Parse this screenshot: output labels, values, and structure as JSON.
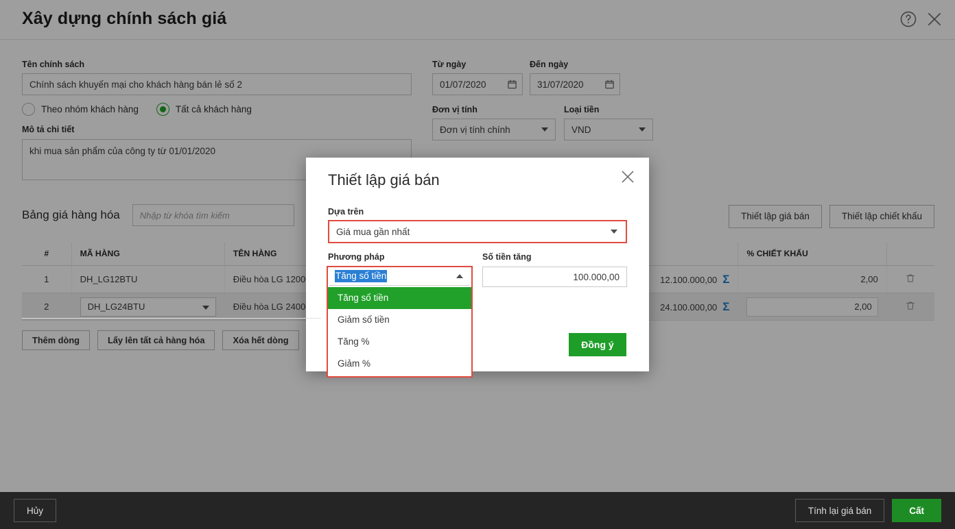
{
  "window": {
    "title": "Xây dựng chính sách giá",
    "help_icon": "help-circle-icon",
    "close_icon": "close-icon"
  },
  "form": {
    "policy_name_label": "Tên chính sách",
    "policy_name_value": "Chính sách khuyến mại cho khách hàng bán lẻ số 2",
    "from_date_label": "Từ ngày",
    "from_date_value": "01/07/2020",
    "to_date_label": "Đến ngày",
    "to_date_value": "31/07/2020",
    "unit_label": "Đơn vị tính",
    "unit_value": "Đơn vị tính chính",
    "currency_label": "Loại tiền",
    "currency_value": "VND",
    "radio_group": [
      {
        "label": "Theo nhóm khách hàng",
        "selected": false
      },
      {
        "label": "Tất cả khách hàng",
        "selected": true
      }
    ],
    "description_label": "Mô tả chi tiết",
    "description_value": "khi mua sản phẩm của công ty từ 01/01/2020"
  },
  "grid_section": {
    "title": "Bảng giá hàng hóa",
    "search_placeholder": "Nhập từ khóa tìm kiếm",
    "search_value": "",
    "action_buttons": [
      "Thiết lập giá bán",
      "Thiết lập chiết khấu"
    ],
    "columns": [
      "#",
      "MÃ HÀNG",
      "TÊN HÀNG",
      "",
      "% CHIẾT KHẤU",
      ""
    ],
    "rows": [
      {
        "index": "1",
        "code": "DH_LG12BTU",
        "name": "Điều hòa LG 12000 BTU",
        "price": "12.100.000,00",
        "sum_icon": "sigma-icon",
        "discount": "2,00",
        "delete_icon": "trash-icon",
        "selected": false
      },
      {
        "index": "2",
        "code": "DH_LG24BTU",
        "name": "Điều hòa LG 24000 BTU",
        "price": "24.100.000,00",
        "sum_icon": "sigma-icon",
        "discount": "2,00",
        "delete_icon": "trash-icon",
        "selected": true
      }
    ],
    "footer_buttons": [
      "Thêm dòng",
      "Lấy lên tất cả hàng hóa",
      "Xóa hết dòng"
    ]
  },
  "footer": {
    "cancel_label": "Hủy",
    "recalc_label": "Tính lại giá bán",
    "save_label": "Cất"
  },
  "modal": {
    "title": "Thiết lập giá bán",
    "close_icon": "close-icon",
    "based_on_label": "Dựa trên",
    "based_on_value": "Giá mua gần nhất",
    "method_label": "Phương pháp",
    "method_value": "Tăng số tiền",
    "amount_label": "Số tiền tăng",
    "amount_value": "100.000,00",
    "ok_label": "Đồng ý",
    "method_options": [
      {
        "label": "Tăng số tiền",
        "active": true
      },
      {
        "label": "Giảm số tiền",
        "active": false
      },
      {
        "label": "Tăng %",
        "active": false
      },
      {
        "label": "Giảm %",
        "active": false
      }
    ]
  },
  "colors": {
    "accent_green": "#1e9e28",
    "highlight_red": "#e04b3f",
    "selection_blue": "#2a7fd4",
    "footer_dark": "#252525",
    "sigma_blue": "#1e7ec8"
  }
}
